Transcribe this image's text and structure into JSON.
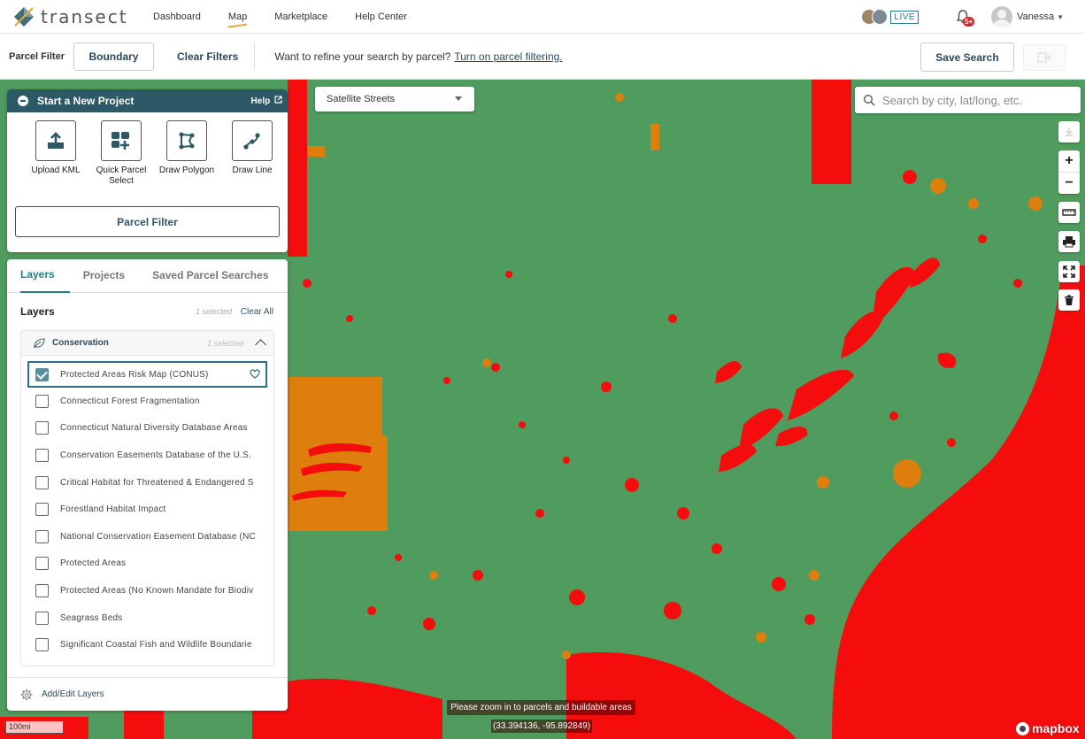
{
  "app": {
    "logo_text": "transect"
  },
  "nav": {
    "links": [
      {
        "label": "Dashboard",
        "active": false
      },
      {
        "label": "Map",
        "active": true
      },
      {
        "label": "Marketplace",
        "active": false
      },
      {
        "label": "Help Center",
        "active": false
      }
    ],
    "live_label": "LIVE",
    "notification_count": "5+",
    "user_name": "Vanessa"
  },
  "filter_bar": {
    "label": "Parcel Filter",
    "boundary_button": "Boundary",
    "clear_button": "Clear Filters",
    "prompt": "Want to refine your search by parcel?",
    "prompt_link": "Turn on parcel filtering.",
    "save_button": "Save Search"
  },
  "map": {
    "style_select": "Satellite Streets",
    "search_placeholder": "Search by city, lat/long, etc.",
    "zoom_notice": "Please zoom in to parcels and buildable areas",
    "coordinates": "(33.394136, -95.892849)",
    "scale": "100mi",
    "attribution": "mapbox",
    "colors": {
      "base": "#4f9c5e",
      "high_risk": "#f50d0d",
      "medium_risk": "#de7e0c"
    }
  },
  "project_panel": {
    "title": "Start a New Project",
    "help": "Help",
    "tools": [
      {
        "label": "Upload KML",
        "icon": "upload-icon"
      },
      {
        "label": "Quick Parcel Select",
        "icon": "quick-parcel-icon"
      },
      {
        "label": "Draw Polygon",
        "icon": "polygon-icon"
      },
      {
        "label": "Draw Line",
        "icon": "line-icon"
      }
    ],
    "parcel_filter_button": "Parcel Filter"
  },
  "layers_panel": {
    "tabs": [
      "Layers",
      "Projects",
      "Saved Parcel Searches"
    ],
    "heading": "Layers",
    "selected_count": "1 selected",
    "clear_all": "Clear All",
    "category": {
      "name": "Conservation",
      "selected_count": "1 selected",
      "layers": [
        {
          "name": "Protected Areas Risk Map (CONUS)",
          "checked": true
        },
        {
          "name": "Connecticut Forest Fragmentation",
          "checked": false
        },
        {
          "name": "Connecticut Natural Diversity Database Areas",
          "checked": false
        },
        {
          "name": "Conservation Easements Database of the U.S.",
          "checked": false
        },
        {
          "name": "Critical Habitat for Threatened & Endangered S",
          "checked": false
        },
        {
          "name": "Forestland Habitat Impact",
          "checked": false
        },
        {
          "name": "National Conservation Easement Database (NC",
          "checked": false
        },
        {
          "name": "Protected Areas",
          "checked": false
        },
        {
          "name": "Protected Areas (No Known Mandate for Biodiv",
          "checked": false
        },
        {
          "name": "Seagrass Beds",
          "checked": false
        },
        {
          "name": "Significant Coastal Fish and Wildlife Boundarie",
          "checked": false
        }
      ]
    },
    "add_edit_layers": "Add/Edit Layers"
  }
}
